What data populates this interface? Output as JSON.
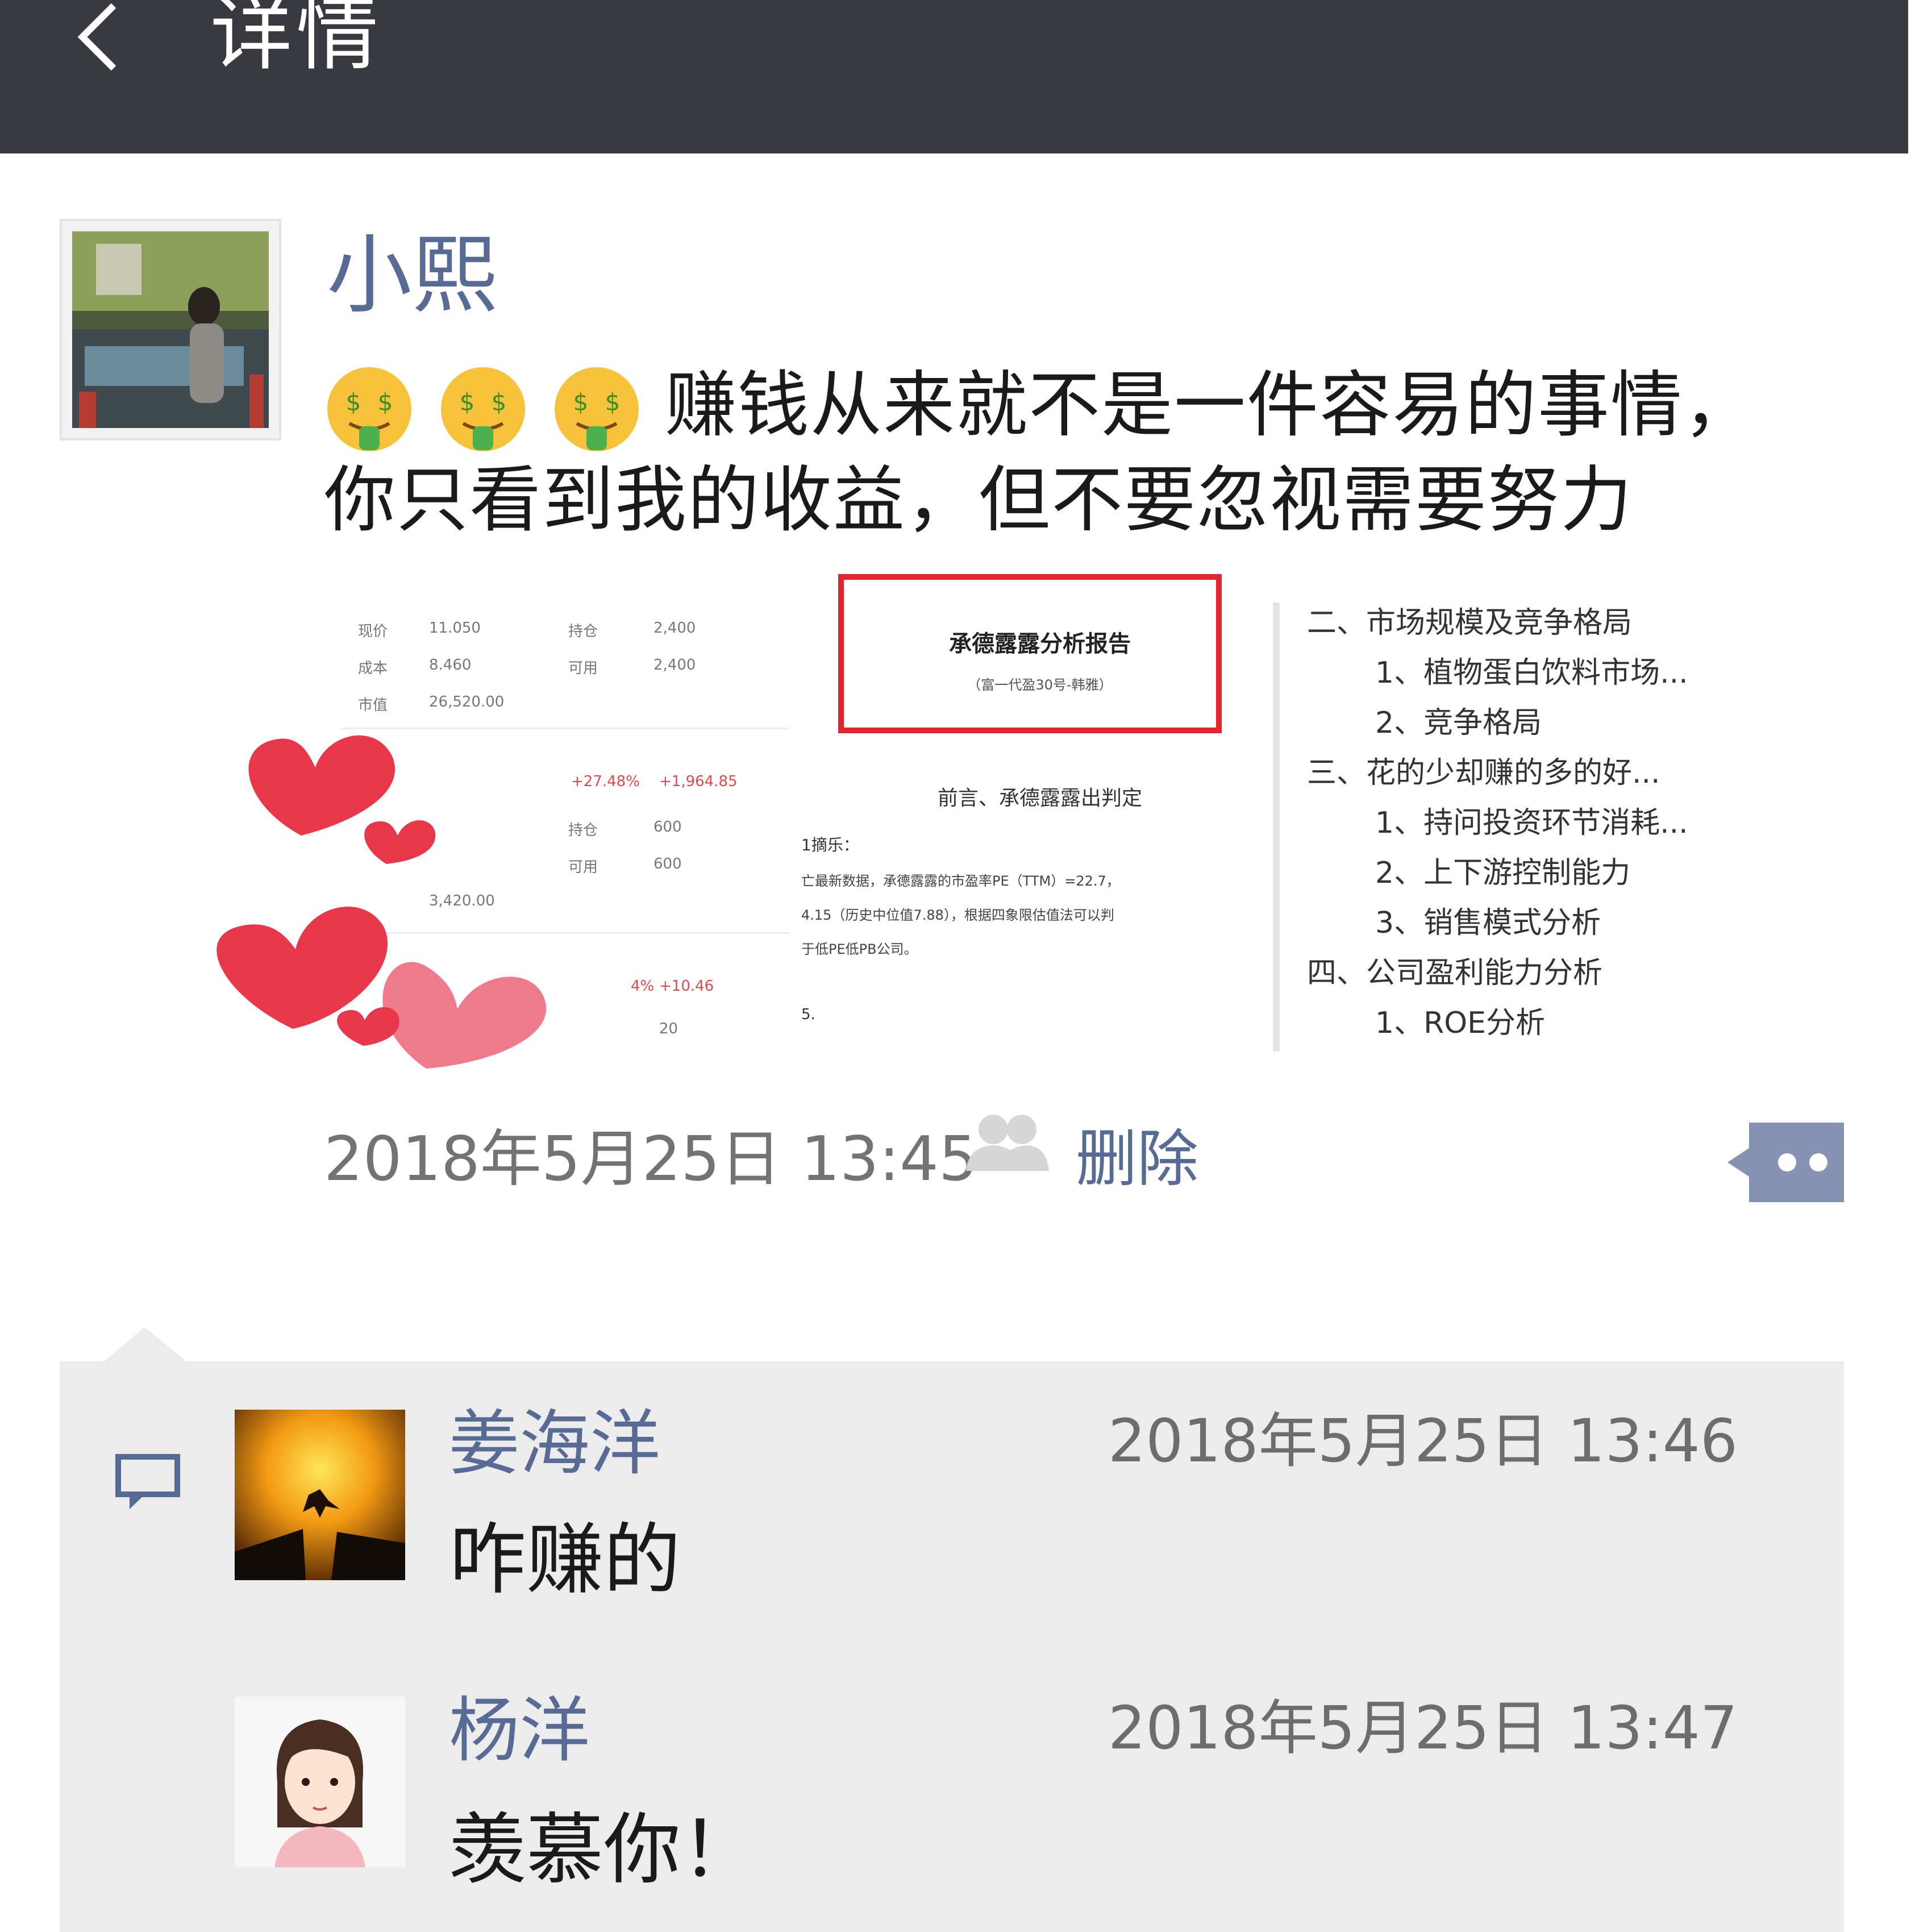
{
  "header": {
    "title": "详情",
    "back_icon": "chevron-left-icon"
  },
  "post": {
    "author": "小熙",
    "emoji": [
      "money-mouth-face-icon",
      "money-mouth-face-icon",
      "money-mouth-face-icon"
    ],
    "text_line_1": "赚钱从来就不是一件容易的事情，",
    "text_line_2": "你只看到我的收益，但不要忽视需要努力",
    "time": "2018年5月25日 13:45",
    "delete_label": "删除",
    "images": {
      "stock": {
        "rows": [
          [
            "现价",
            "11.050",
            "持仓",
            "2,400"
          ],
          [
            "成本",
            "8.460",
            "可用",
            "2,400"
          ],
          [
            "市值",
            "26,520.00",
            "",
            ""
          ]
        ],
        "gain_pct": "+27.48%",
        "gain_amt": "+1,964.85",
        "rows2": [
          [
            "持仓",
            "600"
          ],
          [
            "可用",
            "600"
          ]
        ],
        "value2": "3,420.00",
        "gain_pct2": "4%",
        "gain_amt2": "+10.46",
        "qty3": "20"
      },
      "report": {
        "title": "承德露露分析报告",
        "subtitle": "（富一代盈30号-韩雅）",
        "section": "前言、承德露露出判定",
        "label": "1摘乐：",
        "para_1": "亡最新数据，承德露露的市盈率PE（TTM）=22.7，",
        "para_2": "4.15（历史中位值7.88），根据四象限估值法可以判",
        "para_3": "于低PE低PB公司。",
        "mark": "5."
      },
      "outline": [
        {
          "level": 0,
          "text": "二、市场规模及竞争格局"
        },
        {
          "level": 1,
          "text": "1、植物蛋白饮料市场..."
        },
        {
          "level": 1,
          "text": "2、竞争格局"
        },
        {
          "level": 0,
          "text": "三、花的少却赚的多的好..."
        },
        {
          "level": 1,
          "text": "1、持问投资环节消耗..."
        },
        {
          "level": 1,
          "text": "2、上下游控制能力"
        },
        {
          "level": 1,
          "text": "3、销售模式分析"
        },
        {
          "level": 0,
          "text": "四、公司盈利能力分析"
        },
        {
          "level": 1,
          "text": "1、ROE分析"
        }
      ]
    }
  },
  "comments": [
    {
      "name": "姜海洋",
      "time": "2018年5月25日 13:46",
      "text": "咋赚的"
    },
    {
      "name": "杨洋",
      "time": "2018年5月25日 13:47",
      "text": "羡慕你！"
    }
  ],
  "colors": {
    "topbar": "#393a3f",
    "link": "#576b95",
    "panel": "#ececec",
    "heart": "#e8374a"
  }
}
